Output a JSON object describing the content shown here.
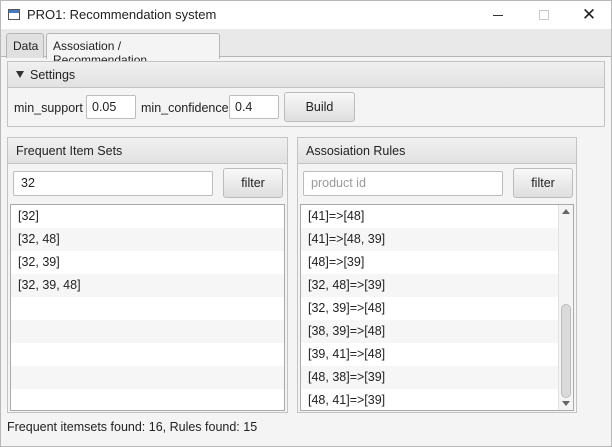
{
  "window": {
    "title": "PRO1: Recommendation system",
    "icon": "app-window-icon"
  },
  "tabs": [
    {
      "label": "Data",
      "selected": false
    },
    {
      "label": "Assosiation / Recommendation",
      "selected": true
    }
  ],
  "settings": {
    "title": "Settings",
    "min_support_label": "min_support",
    "min_support_value": "0.05",
    "min_confidence_label": "min_confidence",
    "min_confidence_value": "0.4",
    "build_label": "Build"
  },
  "frequent": {
    "title": "Frequent Item Sets",
    "search_value": "32",
    "filter_label": "filter",
    "items": [
      "[32]",
      "[32, 48]",
      "[32, 39]",
      "[32, 39, 48]"
    ]
  },
  "rules": {
    "title": "Assosiation Rules",
    "search_placeholder": "product id",
    "filter_label": "filter",
    "items": [
      "[41]=>[48]",
      "[41]=>[48, 39]",
      "[48]=>[39]",
      "[32, 48]=>[39]",
      "[32, 39]=>[48]",
      "[38, 39]=>[48]",
      "[39, 41]=>[48]",
      "[48, 38]=>[39]",
      "[48, 41]=>[39]"
    ]
  },
  "status": "Frequent itemsets found: 16, Rules found: 15"
}
